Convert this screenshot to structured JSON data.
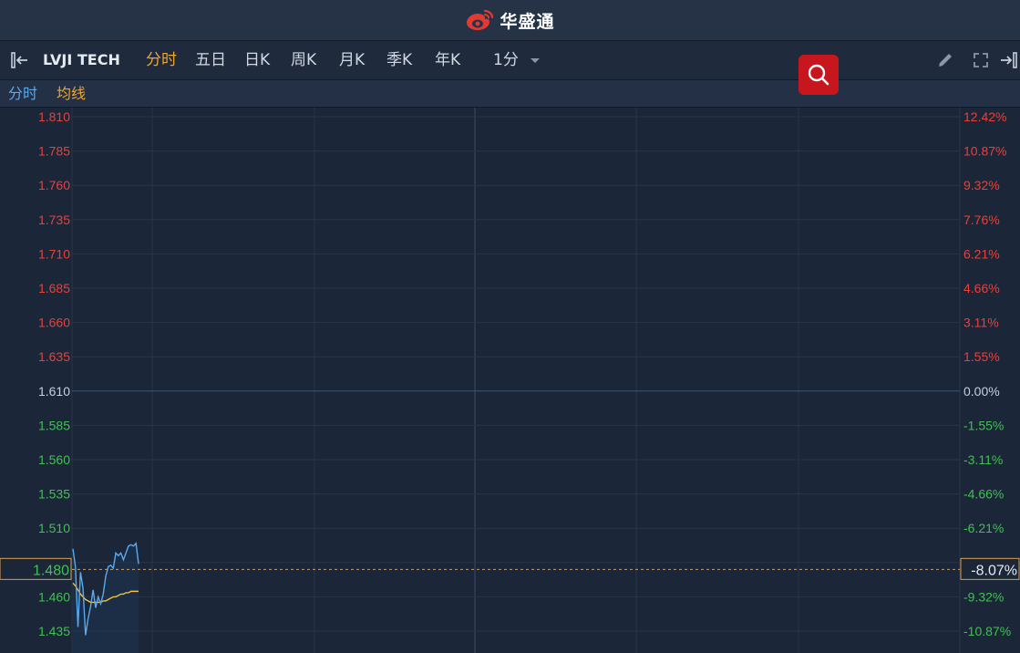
{
  "brand": {
    "name": "华盛通",
    "logo_icon": "weibo-style-eye-logo"
  },
  "toolbar": {
    "symbol": "LVJI TECH",
    "tabs": [
      "分时",
      "五日",
      "日K",
      "周K",
      "月K",
      "季K",
      "年K"
    ],
    "active_tab": "分时",
    "interval": "1分",
    "icons": [
      "collapse-left-icon",
      "search-icon",
      "pencil-icon",
      "fullscreen-icon",
      "collapse-right-icon"
    ]
  },
  "subbar": {
    "mode": "分时",
    "indicator": "均线",
    "mode_color": "#5aa9ef",
    "indicator_color": "#f0a530"
  },
  "colors": {
    "up": "#e8413a",
    "down": "#3fc24f",
    "neutral": "#c8d0dc",
    "price_line": "#5aa9ef",
    "avg_line": "#f0c040",
    "cursor": "#d9a050"
  },
  "chart_data": {
    "type": "line",
    "title": "",
    "base_price": 1.61,
    "ylim": [
      1.43,
      1.81
    ],
    "y_ticks": [
      "1.810",
      "1.785",
      "1.760",
      "1.735",
      "1.710",
      "1.685",
      "1.660",
      "1.635",
      "1.610",
      "1.585",
      "1.560",
      "1.535",
      "1.510",
      "1.485",
      "1.460",
      "1.435"
    ],
    "y_percent_ticks": [
      "12.42%",
      "10.87%",
      "9.32%",
      "7.76%",
      "6.21%",
      "4.66%",
      "3.11%",
      "1.55%",
      "0.00%",
      "-1.55%",
      "-3.11%",
      "-4.66%",
      "-6.21%",
      "-7.76%",
      "-9.32%",
      "-10.87%"
    ],
    "cursor": {
      "price": "1.480",
      "percent": "-8.07%"
    },
    "series": [
      {
        "name": "",
        "values": [
          1.495,
          1.482,
          1.438,
          1.478,
          1.466,
          1.432,
          1.444,
          1.453,
          1.465,
          1.452,
          1.46,
          1.455,
          1.462,
          1.475,
          1.482,
          1.483,
          1.481,
          1.492,
          1.49,
          1.492,
          1.487,
          1.492,
          1.497,
          1.498,
          1.497,
          1.499,
          1.484
        ]
      },
      {
        "name": "",
        "values": [
          1.47,
          1.468,
          1.465,
          1.462,
          1.46,
          1.458,
          1.457,
          1.456,
          1.456,
          1.456,
          1.456,
          1.456,
          1.457,
          1.457,
          1.458,
          1.459,
          1.46,
          1.46,
          1.461,
          1.462,
          1.462,
          1.463,
          1.463,
          1.464,
          1.464,
          1.464,
          1.464
        ]
      }
    ]
  }
}
